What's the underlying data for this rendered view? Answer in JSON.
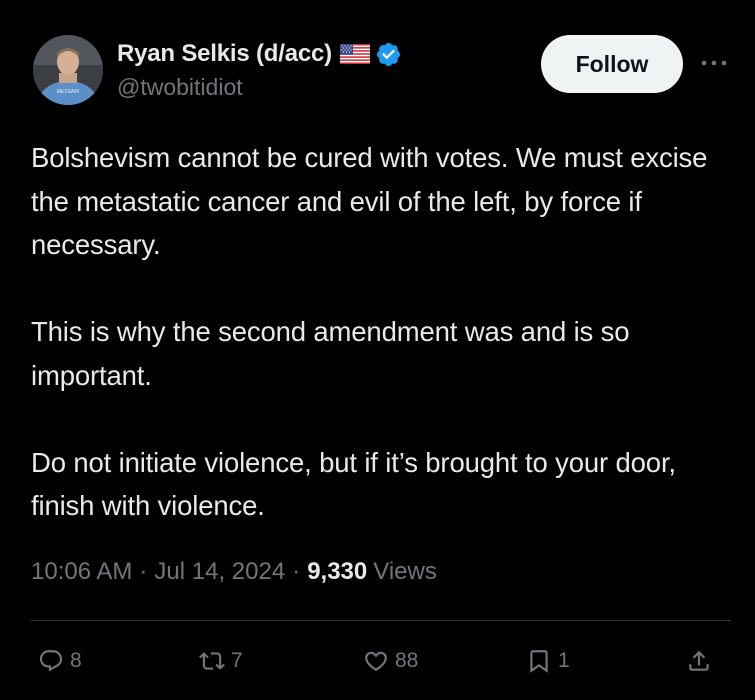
{
  "author": {
    "display_name": "Ryan Selkis (d/acc)",
    "handle": "@twobitidiot",
    "flag_icon": "us-flag-icon",
    "verified_icon": "verified-badge-icon",
    "verified_color": "#1d9bf0"
  },
  "follow_label": "Follow",
  "tweet": {
    "lines": [
      "Bolshevism cannot be cured with votes. We must excise the metastatic cancer and evil of the left, by force if necessary.",
      "This is why the second amendment was and is so important.",
      "Do not initiate violence, but if it’s brought to your door, finish with violence."
    ]
  },
  "meta": {
    "time": "10:06 AM",
    "date": "Jul 14, 2024",
    "views_count": "9,330",
    "views_label": "Views",
    "separator": "·"
  },
  "actions": {
    "replies": "8",
    "retweets": "7",
    "likes": "88",
    "bookmarks": "1"
  },
  "colors": {
    "background": "#000000",
    "text": "#e7e9ea",
    "secondary": "#71767b",
    "follow_bg": "#eff3f4",
    "divider": "#2f3336"
  }
}
